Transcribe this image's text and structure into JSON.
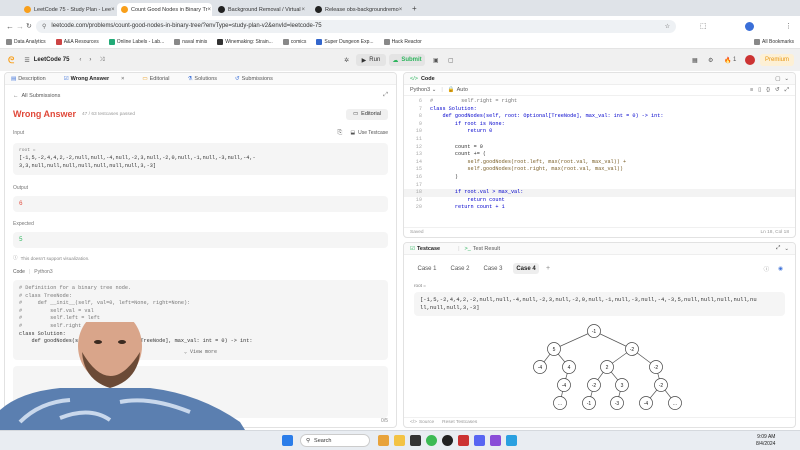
{
  "browser": {
    "tabs": [
      {
        "title": "LeetCode 75 - Study Plan - Lee",
        "active": false,
        "favicon_color": "#f89f1b"
      },
      {
        "title": "Count Good Nodes in Binary Tr",
        "active": true,
        "favicon_color": "#f89f1b"
      },
      {
        "title": "Background Removal / Virtual",
        "active": false,
        "favicon_color": "#222222"
      },
      {
        "title": "Release obs-backgroundremo",
        "active": false,
        "favicon_color": "#222222"
      }
    ],
    "url": "leetcode.com/problems/count-good-nodes-in-binary-tree/?envType=study-plan-v2&envId=leetcode-75",
    "bookmarks": [
      "Data Analytics",
      "A&A Resources",
      "Online Labels - Lab...",
      "naval minis",
      "Winemaking: Strain...",
      "comics",
      "Super Dungeon Exp...",
      "Hack Reactor"
    ],
    "all_bookmarks": "All Bookmarks"
  },
  "nav": {
    "study_plan": "LeetCode 75",
    "run": "Run",
    "submit": "Submit",
    "streak": "1",
    "premium": "Premium"
  },
  "left": {
    "tabs": [
      "Description",
      "Wrong Answer",
      "Editorial",
      "Solutions",
      "Submissions"
    ],
    "all_submissions": "All Submissions",
    "result_title": "Wrong Answer",
    "result_detail": "47 / 63 testcases passed",
    "editorial_btn": "Editorial",
    "input_label": "Input",
    "use_testcase": "Use Testcase",
    "root_label": "root =",
    "input_line1": "[-1,5,-2,4,4,2,-2,null,null,-4,null,-2,3,null,-2,0,null,-1,null,-3,null,-4,-",
    "input_line2": "3,3,null,null,null,null,null,null,null,3,-3]",
    "output_label": "Output",
    "output_value": "6",
    "expected_label": "Expected",
    "expected_value": "5",
    "visualize_note": "This doesn't support visualization.",
    "code_label": "Code",
    "code_lang": "Python3",
    "code_lines": [
      "# Definition for a binary tree node.",
      "# class TreeNode:",
      "#     def __init__(self, val=0, left=None, right=None):",
      "#         self.val = val",
      "#         self.left = left",
      "#         self.right = right",
      "class Solution:",
      "    def goodNodes(self, root: Optional[TreeNode], max_val: int = 0) -> int:"
    ],
    "view_more": "View more",
    "pager": "0/5"
  },
  "code": {
    "title": "Code",
    "language": "Python3",
    "auto": "Auto",
    "lines": [
      {
        "n": "6",
        "text": "#         self.right = right"
      },
      {
        "n": "7",
        "text": "class Solution:"
      },
      {
        "n": "8",
        "text": "    def goodNodes(self, root: Optional[TreeNode], max_val: int = 0) -> int:"
      },
      {
        "n": "9",
        "text": "        if root is None:"
      },
      {
        "n": "10",
        "text": "            return 0"
      },
      {
        "n": "11",
        "text": ""
      },
      {
        "n": "12",
        "text": "        count = 0"
      },
      {
        "n": "13",
        "text": "        count += ("
      },
      {
        "n": "14",
        "text": "            self.goodNodes(root.left, max(root.val, max_val)) +"
      },
      {
        "n": "15",
        "text": "            self.goodNodes(root.right, max(root.val, max_val))"
      },
      {
        "n": "16",
        "text": "        )"
      },
      {
        "n": "17",
        "text": ""
      },
      {
        "n": "18",
        "text": "        if root.val > max_val:"
      },
      {
        "n": "19",
        "text": "            return count"
      },
      {
        "n": "20",
        "text": "        return count + 1"
      }
    ],
    "saved": "Saved",
    "cursor": "Ln 18, Col 18"
  },
  "test": {
    "tabs": [
      "Testcase",
      "Test Result"
    ],
    "cases": [
      "Case 1",
      "Case 2",
      "Case 3",
      "Case 4"
    ],
    "add": "+",
    "root_label": "root =",
    "value_line1": "[-1,5,-2,4,4,2,-2,null,null,-4,null,-2,3,null,-2,0,null,-1,null,-3,null,-4,-3,5,null,null,null,null,nu",
    "value_line2": "ll,null,null,3,-3]",
    "source": "Source",
    "reset": "Reset Testcases",
    "tree_nodes": [
      {
        "id": "n0",
        "label": "-1"
      },
      {
        "id": "n1",
        "label": "5"
      },
      {
        "id": "n2",
        "label": "-2"
      },
      {
        "id": "n3",
        "label": "-4"
      },
      {
        "id": "n4",
        "label": "4"
      },
      {
        "id": "n5",
        "label": "2"
      },
      {
        "id": "n6",
        "label": "-2"
      },
      {
        "id": "n7",
        "label": "-4"
      },
      {
        "id": "n8",
        "label": "-2"
      },
      {
        "id": "n9",
        "label": "3"
      },
      {
        "id": "n10",
        "label": "-2"
      },
      {
        "id": "n11",
        "label": "..."
      },
      {
        "id": "n12",
        "label": "-1"
      },
      {
        "id": "n13",
        "label": "-3"
      },
      {
        "id": "n14",
        "label": "-4"
      },
      {
        "id": "n15",
        "label": "..."
      }
    ]
  },
  "taskbar": {
    "search": "Search",
    "time": "9:09 AM",
    "date": "8/4/2024"
  }
}
